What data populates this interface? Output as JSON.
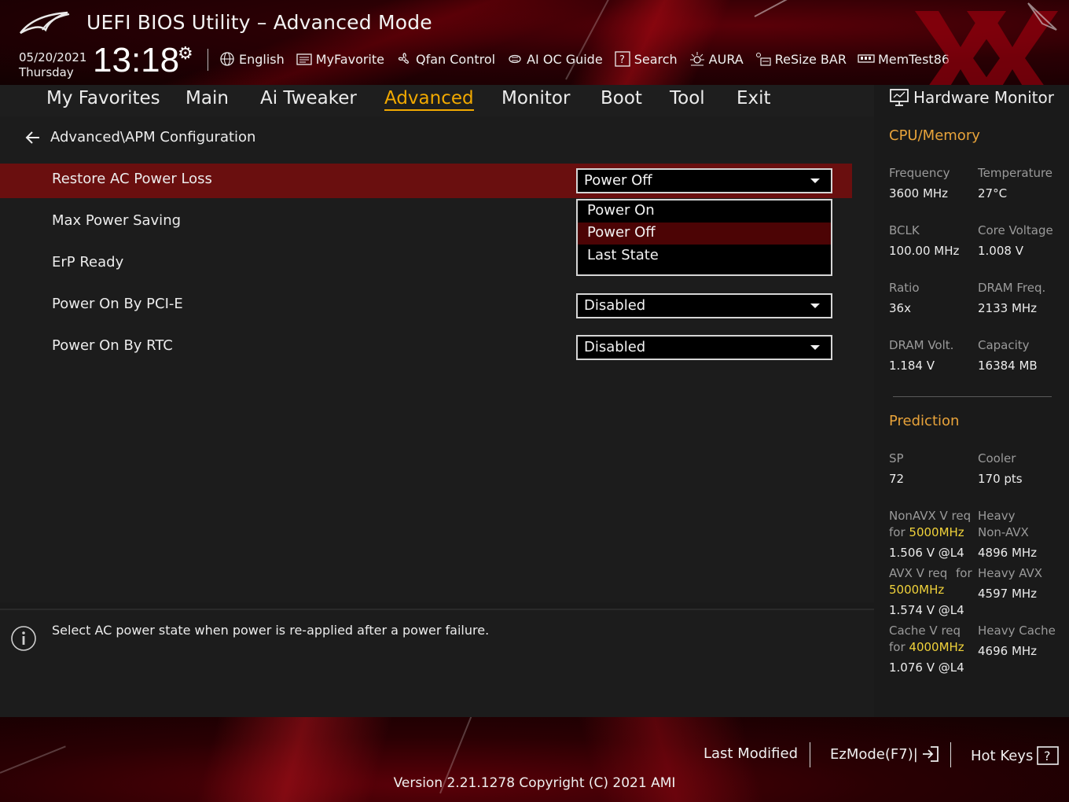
{
  "header": {
    "title": "UEFI BIOS Utility – Advanced Mode",
    "date": "05/20/2021",
    "weekday": "Thursday",
    "time": "13:18",
    "tools": [
      {
        "label": "English",
        "icon": "globe-icon"
      },
      {
        "label": "MyFavorite",
        "icon": "favorite-icon"
      },
      {
        "label": "Qfan Control",
        "icon": "fan-icon"
      },
      {
        "label": "AI OC Guide",
        "icon": "chip-icon"
      },
      {
        "label": "Search",
        "icon": "help-search-icon"
      },
      {
        "label": "AURA",
        "icon": "aura-icon"
      },
      {
        "label": "ReSize BAR",
        "icon": "resize-bar-icon"
      },
      {
        "label": "MemTest86",
        "icon": "memory-icon"
      }
    ]
  },
  "nav": {
    "tabs": [
      "My Favorites",
      "Main",
      "Ai Tweaker",
      "Advanced",
      "Monitor",
      "Boot",
      "Tool",
      "Exit"
    ],
    "active": "Advanced"
  },
  "main": {
    "breadcrumb": "Advanced\\APM Configuration",
    "settings": [
      {
        "label": "Restore AC Power Loss",
        "value": "Power Off"
      },
      {
        "label": "Max Power Saving"
      },
      {
        "label": "ErP Ready"
      },
      {
        "label": "Power On By PCI-E",
        "value": "Disabled"
      },
      {
        "label": "Power On By RTC",
        "value": "Disabled"
      }
    ],
    "dropdown_options": [
      "Power On",
      "Power Off",
      "Last State"
    ],
    "dropdown_selected": "Power Off"
  },
  "help": {
    "text": "Select AC power state when power is re-applied after a power failure."
  },
  "hw_monitor": {
    "title": "Hardware Monitor",
    "cpu_memory_title": "CPU/Memory",
    "frequency_label": "Frequency",
    "frequency": "3600 MHz",
    "temperature_label": "Temperature",
    "temperature": "27°C",
    "bclk_label": "BCLK",
    "bclk": "100.00 MHz",
    "core_voltage_label": "Core Voltage",
    "core_voltage": "1.008 V",
    "ratio_label": "Ratio",
    "ratio": "36x",
    "dram_freq_label": "DRAM Freq.",
    "dram_freq": "2133 MHz",
    "dram_volt_label": "DRAM Volt.",
    "dram_volt": "1.184 V",
    "capacity_label": "Capacity",
    "capacity": "16384 MB",
    "prediction_title": "Prediction",
    "sp_label": "SP",
    "sp": "72",
    "cooler_label": "Cooler",
    "cooler": "170 pts",
    "nonavx_label_1": "NonAVX V req",
    "nonavx_label_for": "for",
    "nonavx_freq": "5000MHz",
    "nonavx_value": "1.506 V @L4",
    "heavy_nonavx_label_1": "Heavy",
    "heavy_nonavx_label_2": "Non-AVX",
    "heavy_nonavx_value": "4896 MHz",
    "avx_label_1": "AVX V req",
    "avx_label_for": "for",
    "avx_freq": "5000MHz",
    "avx_value": "1.574 V @L4",
    "heavy_avx_label": "Heavy AVX",
    "heavy_avx_value": "4597 MHz",
    "cache_label_1": "Cache V req",
    "cache_label_for": "for",
    "cache_freq": "4000MHz",
    "cache_value": "1.076 V @L4",
    "heavy_cache_label": "Heavy Cache",
    "heavy_cache_value": "4696 MHz"
  },
  "footer": {
    "last_modified": "Last Modified",
    "ezmode": "EzMode(F7)|",
    "hot_keys": "Hot Keys",
    "version": "Version 2.21.1278 Copyright (C) 2021 AMI"
  },
  "colors": {
    "accent": "#f2a900",
    "selection_red": "#6a0f0f",
    "section_orange": "#e8a33a",
    "highlight_yellow": "#f0d23a"
  }
}
